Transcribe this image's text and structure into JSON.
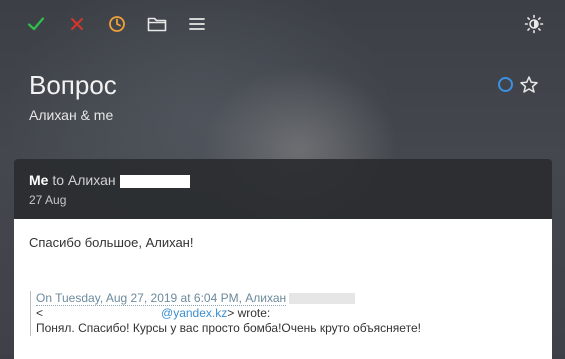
{
  "toolbar": {
    "icons": [
      "checkmark-icon",
      "close-icon",
      "clock-icon",
      "folder-icon",
      "menu-icon",
      "brightness-icon"
    ],
    "colors": {
      "check": "#2fbf4a",
      "close": "#d6342c",
      "clock": "#f0a03a",
      "neutral": "#e8e8e8"
    }
  },
  "thread": {
    "subject": "Вопрос",
    "participants": "Алихан & me",
    "accent": "#3d8fe0"
  },
  "message": {
    "from": "Me",
    "to_prefix": "to",
    "to_name": "Алихан",
    "date": "27 Aug",
    "greeting": "Спасибо большое, Алихан!",
    "quote": {
      "header": "On Tuesday, Aug 27, 2019 at 6:04 PM, Алихан",
      "email_open": "<",
      "email_domain": "@yandex.kz",
      "email_close": "> wrote:",
      "text": "Понял. Спасибо! Курсы у вас просто бомба!Очень круто объясняете!"
    }
  }
}
